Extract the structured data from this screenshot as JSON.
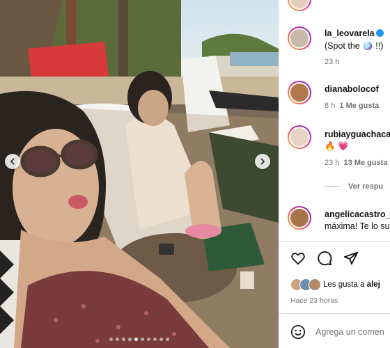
{
  "post": {
    "carousel_dots": 10,
    "active_dot": 4
  },
  "comments": [
    {
      "username": "la_leovarela",
      "text": "(Spot the 🪩 !!)",
      "time": "23 h",
      "likes": "",
      "avatar_color": "#c9b9a8"
    },
    {
      "username": "dianabolocof",
      "text": "",
      "time": "8 h",
      "likes": "1 Me gusta",
      "avatar_color": "#b07a4a"
    },
    {
      "username": "rubiayguachaca",
      "text": "🔥 💗",
      "time": "23 h",
      "likes": "13 Me gusta",
      "avatar_color": "#e8d4c4"
    },
    {
      "username": "angelicacastro_",
      "text": "máxima! Te lo su",
      "time": "",
      "likes": "",
      "avatar_color": "#a8744a"
    }
  ],
  "view_replies": "Ver respu",
  "likes_text": "Les gusta a",
  "likes_user": "alej",
  "timestamp": "Hace 23 horas",
  "add_comment_placeholder": "Agrega un comen",
  "colors": {
    "accent": "#1d9bf0",
    "muted": "#737373"
  }
}
